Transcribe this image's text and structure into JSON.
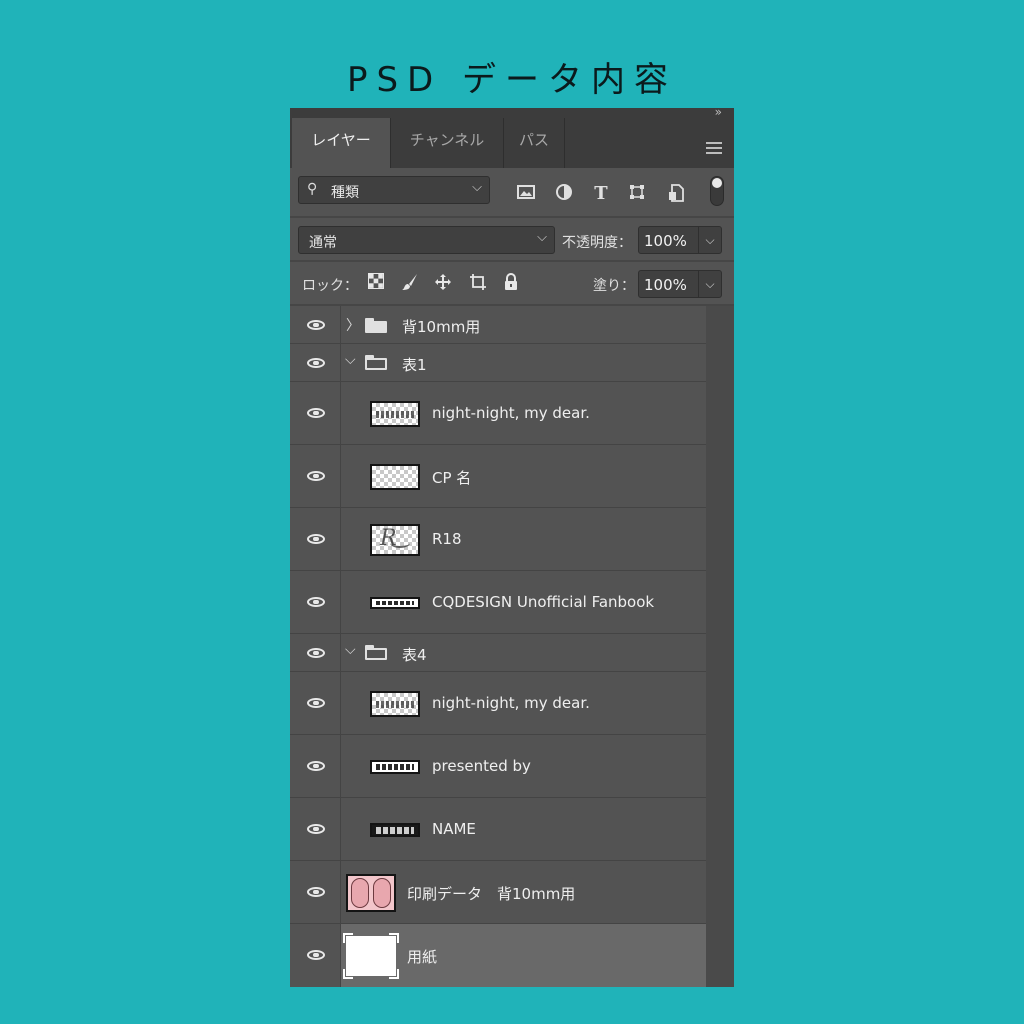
{
  "page": {
    "title": "PSD データ内容"
  },
  "panel": {
    "collapse_icon": "»",
    "tabs": [
      {
        "label": "レイヤー",
        "active": true
      },
      {
        "label": "チャンネル",
        "active": false
      },
      {
        "label": "パス",
        "active": false
      }
    ],
    "menu_icon": "hamburger-icon",
    "filter": {
      "icon": "search-icon",
      "value": "種類"
    },
    "filter_icons": [
      "image-filter-icon",
      "adjustment-filter-icon",
      "type-filter-icon",
      "shape-filter-icon",
      "smart-object-filter-icon"
    ],
    "blend_mode": "通常",
    "opacity_label": "不透明度：",
    "opacity_value": "100%",
    "lock_label": "ロック：",
    "lock_icons": [
      "lock-transparency-icon",
      "lock-image-icon",
      "lock-position-icon",
      "lock-artboard-icon",
      "lock-all-icon"
    ],
    "fill_label": "塗り：",
    "fill_value": "100%"
  },
  "layers": [
    {
      "name": "背10mm用",
      "kind": "group",
      "expanded": false,
      "visible": true
    },
    {
      "name": "表1",
      "kind": "group",
      "expanded": true,
      "visible": true
    },
    {
      "name": "night-night,  my dear.",
      "kind": "layer",
      "visible": true
    },
    {
      "name": "CP 名",
      "kind": "layer",
      "visible": true
    },
    {
      "name": "R18",
      "kind": "layer",
      "visible": true
    },
    {
      "name": "CQDESIGN  Unofficial Fanbook",
      "kind": "layer",
      "visible": true
    },
    {
      "name": "表4",
      "kind": "group",
      "expanded": true,
      "visible": true
    },
    {
      "name": "night-night,  my dear.",
      "kind": "layer",
      "visible": true
    },
    {
      "name": "presented by",
      "kind": "layer",
      "visible": true
    },
    {
      "name": "NAME",
      "kind": "layer",
      "visible": true
    },
    {
      "name": "印刷データ　背10mm用",
      "kind": "layer",
      "visible": true
    },
    {
      "name": "用紙",
      "kind": "layer",
      "visible": true,
      "selected": true
    }
  ],
  "colors": {
    "background": "#20b3b9",
    "panel": "#535353",
    "tabbar": "#3c3c3c",
    "selected_row": "#696969"
  }
}
